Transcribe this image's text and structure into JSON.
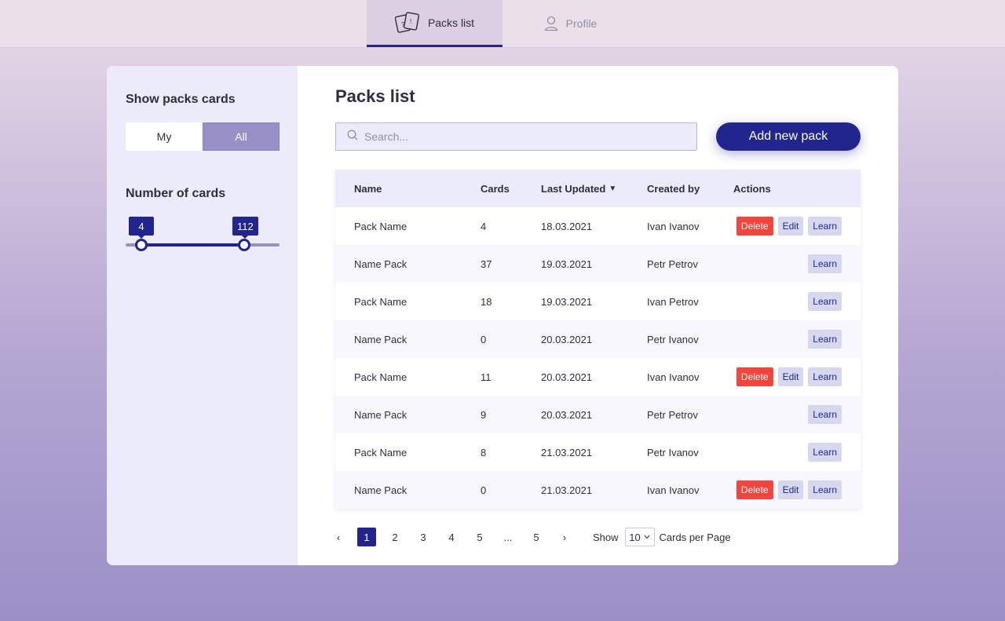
{
  "header": {
    "tabs": [
      {
        "label": "Packs list",
        "icon": "cards-icon",
        "active": true
      },
      {
        "label": "Profile",
        "icon": "user-icon",
        "active": false
      }
    ]
  },
  "sidebar": {
    "title": "Show packs cards",
    "toggle": {
      "my": "My",
      "all": "All",
      "selected": "All"
    },
    "range_title": "Number of cards",
    "range": {
      "min_value": "4",
      "max_value": "112"
    }
  },
  "main": {
    "title": "Packs list",
    "search": {
      "placeholder": "Search...",
      "value": ""
    },
    "add_button": "Add new pack",
    "table": {
      "columns": {
        "name": "Name",
        "cards": "Cards",
        "updated": "Last Updated",
        "created_by": "Created by",
        "actions": "Actions"
      },
      "sort_indicator": "▼",
      "rows": [
        {
          "name": "Pack Name",
          "cards": "4",
          "updated": "18.03.2021",
          "created_by": "Ivan Ivanov",
          "owner": true
        },
        {
          "name": "Name Pack",
          "cards": "37",
          "updated": "19.03.2021",
          "created_by": "Petr Petrov",
          "owner": false
        },
        {
          "name": "Pack Name",
          "cards": "18",
          "updated": "19.03.2021",
          "created_by": "Ivan Petrov",
          "owner": false
        },
        {
          "name": "Name Pack",
          "cards": "0",
          "updated": "20.03.2021",
          "created_by": "Petr Ivanov",
          "owner": false
        },
        {
          "name": "Pack Name",
          "cards": "11",
          "updated": "20.03.2021",
          "created_by": "Ivan Ivanov",
          "owner": true
        },
        {
          "name": "Name Pack",
          "cards": "9",
          "updated": "20.03.2021",
          "created_by": "Petr Petrov",
          "owner": false
        },
        {
          "name": "Pack Name",
          "cards": "8",
          "updated": "21.03.2021",
          "created_by": "Petr Ivanov",
          "owner": false
        },
        {
          "name": "Name Pack",
          "cards": "0",
          "updated": "21.03.2021",
          "created_by": "Ivan Ivanov",
          "owner": true
        }
      ],
      "action_labels": {
        "delete": "Delete",
        "edit": "Edit",
        "learn": "Learn"
      }
    },
    "pagination": {
      "prev": "‹",
      "pages": [
        "1",
        "2",
        "3",
        "4",
        "5",
        "...",
        "5"
      ],
      "current": "1",
      "next": "›",
      "show_label": "Show",
      "per_page": "10",
      "per_page_suffix": "Cards per Page"
    }
  },
  "colors": {
    "accent": "#21268f",
    "delete": "#f1453d",
    "toggle_active": "#9890c7",
    "sidebar_bg": "#ecebf9"
  }
}
